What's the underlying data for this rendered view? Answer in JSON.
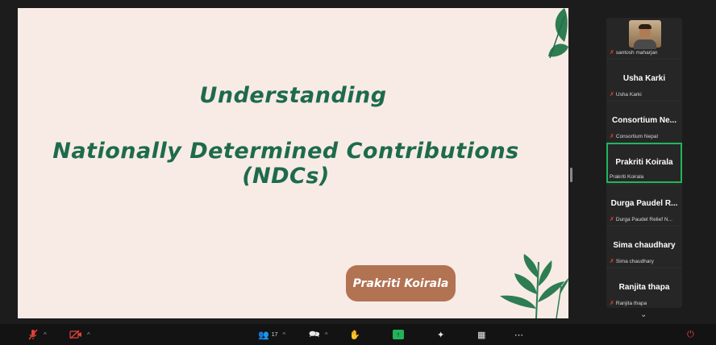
{
  "slide": {
    "title_line1": "Understanding",
    "title_line2": "Nationally Determined Contributions (NDCs)",
    "presenter": "Prakriti Koirala"
  },
  "participants": [
    {
      "display": "",
      "label": "santosh maharjan",
      "muted": true,
      "has_video": true
    },
    {
      "display": "Usha Karki",
      "label": "Usha Karki",
      "muted": true
    },
    {
      "display": "Consortium Ne...",
      "label": "Consortium Nepal",
      "muted": true
    },
    {
      "display": "Prakriti Koirala",
      "label": "Prakriti Koirala",
      "muted": false,
      "speaking": true
    },
    {
      "display": "Durga Paudel R...",
      "label": "Durga Paudel Relief N...",
      "muted": true
    },
    {
      "display": "Sima chaudhary",
      "label": "Sima chaudhary",
      "muted": true
    },
    {
      "display": "Ranjita thapa",
      "label": "Ranjita thapa",
      "muted": true
    }
  ],
  "toolbar": {
    "participants_count": "17"
  },
  "colors": {
    "slide_bg": "#f8ebe6",
    "title_green": "#1d6b4c",
    "pill_brown": "#b27353",
    "active_border": "#22b55a",
    "muted_red": "#e0413a"
  }
}
